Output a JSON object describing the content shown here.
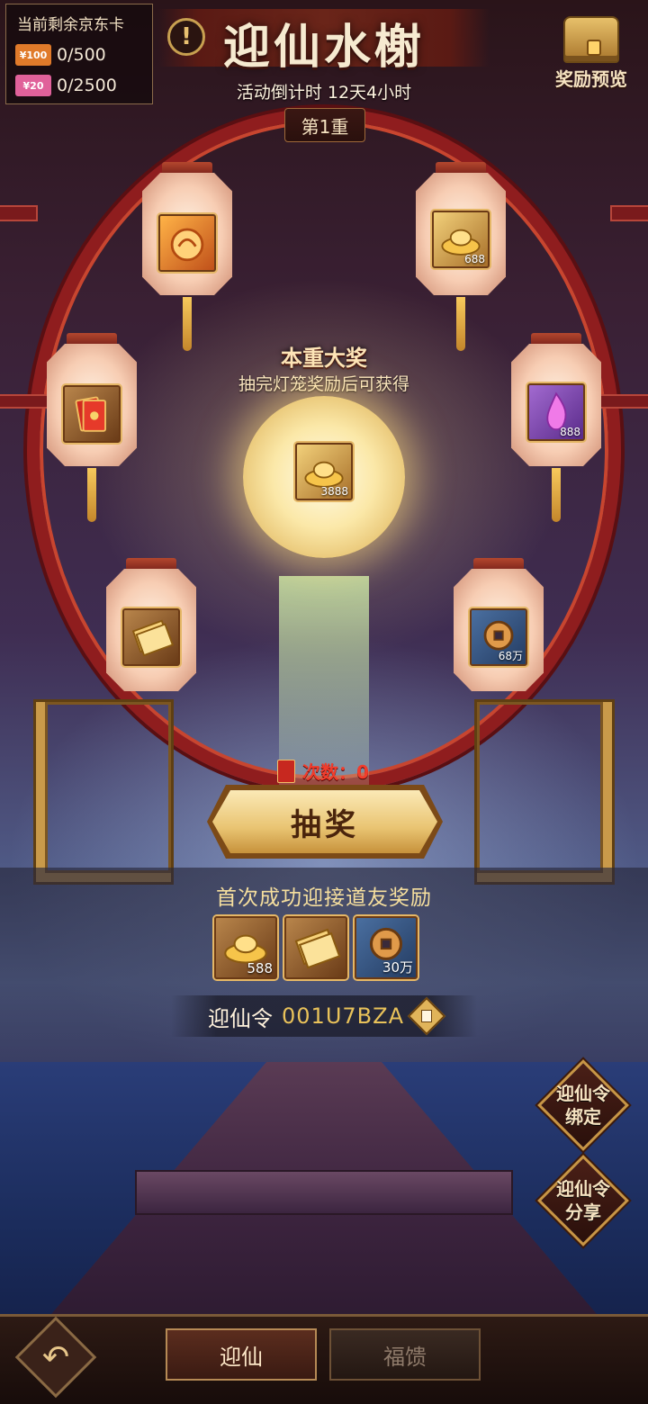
{
  "header": {
    "card_box_title": "当前剩余京东卡",
    "cards": [
      {
        "chip": "¥100",
        "value": "0/500",
        "color": "#e07a2a"
      },
      {
        "chip": "¥20",
        "value": "0/2500",
        "color": "#e0619a"
      }
    ],
    "title": "迎仙水榭",
    "countdown": "活动倒计时 12天4小时",
    "stage": "第1重",
    "info_icon": "!",
    "reward_preview_label": "奖励预览"
  },
  "lanterns": [
    {
      "icon": "fire-orb-icon",
      "count": ""
    },
    {
      "icon": "gold-ingot-icon",
      "count": "688"
    },
    {
      "icon": "red-envelope-icon",
      "count": ""
    },
    {
      "icon": "purple-flame-icon",
      "count": "888"
    },
    {
      "icon": "ticket-icon",
      "count": ""
    },
    {
      "icon": "copper-coin-icon",
      "count": "68万"
    }
  ],
  "grand_prize": {
    "title": "本重大奖",
    "subtitle": "抽完灯笼奖励后可获得",
    "icon": "gold-ingot-icon",
    "count": "3888"
  },
  "draw": {
    "count_text": "次数：0",
    "button_label": "抽奖"
  },
  "first_reward": {
    "title": "首次成功迎接道友奖励",
    "items": [
      {
        "icon": "gold-ingot-icon",
        "count": "588"
      },
      {
        "icon": "ticket-icon",
        "count": ""
      },
      {
        "icon": "copper-coin-icon",
        "count": "30万"
      }
    ],
    "code_label": "迎仙令",
    "code_value": "001U7BZA"
  },
  "side_buttons": {
    "bind": "迎仙令\n绑定",
    "share": "迎仙令\n分享"
  },
  "bottom_tabs": {
    "active": "迎仙",
    "inactive": "福馈"
  }
}
